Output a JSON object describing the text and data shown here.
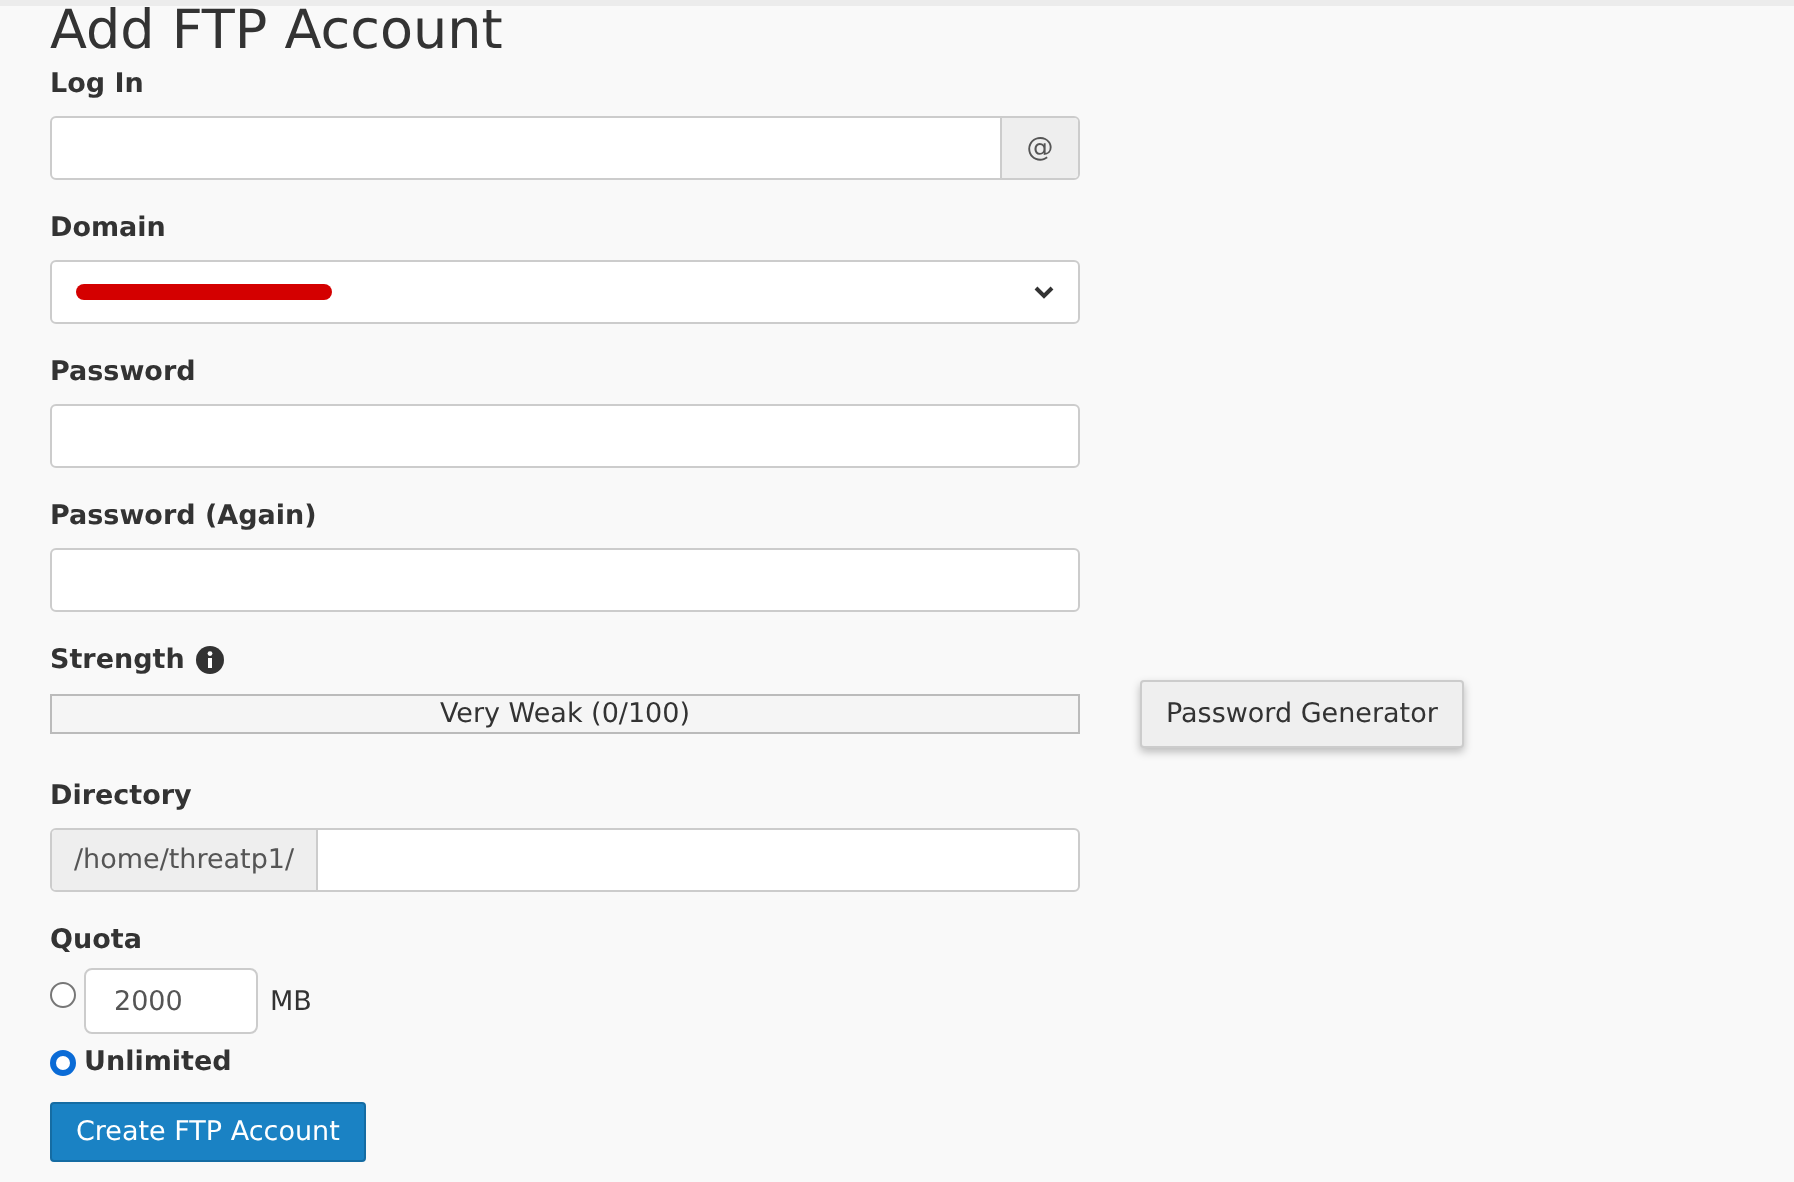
{
  "title": "Add FTP Account",
  "login": {
    "label": "Log In",
    "suffix": "@"
  },
  "domain": {
    "label": "Domain",
    "redacted": true
  },
  "password": {
    "label": "Password"
  },
  "password_again": {
    "label": "Password (Again)"
  },
  "strength": {
    "label": "Strength",
    "level": 0,
    "reading": "Very Weak (0/100)",
    "generator_button": "Password Generator"
  },
  "directory": {
    "label": "Directory",
    "prefix": "/home/threatp1/"
  },
  "quota": {
    "label": "Quota",
    "options": [
      {
        "kind": "amount",
        "value": "2000",
        "unit": "MB",
        "selected": false
      },
      {
        "kind": "label",
        "label": "Unlimited",
        "selected": true
      }
    ]
  },
  "submit_button": "Create FTP Account"
}
